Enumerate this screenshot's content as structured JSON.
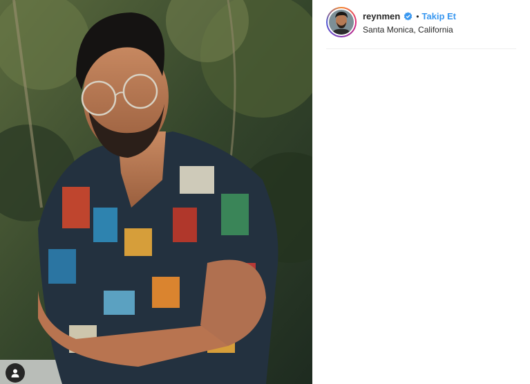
{
  "post": {
    "username": "reynmen",
    "separator": "•",
    "follow_label": "Takip Et",
    "location": "Santa Monica, California",
    "verified": true
  },
  "colors": {
    "follow": "#3897f0",
    "verified_badge": "#3897f0",
    "text": "#262626",
    "divider": "#efefef"
  },
  "icons": {
    "avatar_story_ring": "gradient-ring",
    "verified": "verified-badge-icon",
    "tag": "user-tag-icon"
  }
}
